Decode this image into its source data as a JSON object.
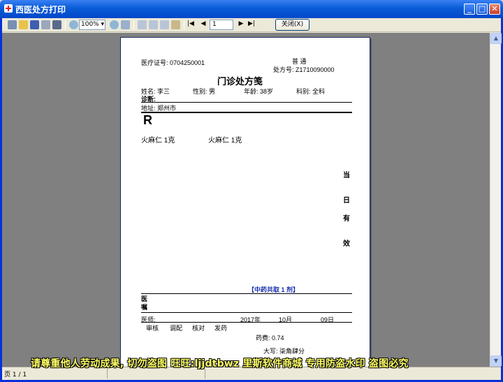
{
  "window": {
    "title": "西医处方打印"
  },
  "toolbar": {
    "zoom": "100%",
    "page": "1",
    "close_label": "关闭(X)"
  },
  "status": {
    "page_text": "页 1 / 1"
  },
  "prescription": {
    "medical_id": "医疗证号: 0704250001",
    "type": "普  通",
    "rx_number": "处方号: Z1710090000",
    "title": "门诊处方笺",
    "name": "姓名: 李三",
    "gender": "性别: 男",
    "age": "年龄: 38岁",
    "department": "科别: 全科",
    "diagnosis": "诊断:",
    "address": "地址: 郑州市",
    "rx_symbol": "R",
    "medicines": [
      "火麻仁 1克",
      "火麻仁 1克"
    ],
    "validity": [
      "当",
      "日",
      "有",
      "效"
    ],
    "total_doses": "【中药共取 1 剂】",
    "advice": [
      "医",
      "嘱"
    ],
    "doctor": "医师:",
    "year": "2017年",
    "month": "10月",
    "day": "09日",
    "roles": [
      "审核",
      "调配",
      "核对",
      "发药"
    ],
    "fee": "药费: 0.74",
    "fee_upper": "大写: 柒角肆分"
  },
  "watermark": "请尊重他人劳动成果, 切勿盗图 旺旺:ljjdtbwz 里斯软件商城 专用防盗水印 盗图必究"
}
